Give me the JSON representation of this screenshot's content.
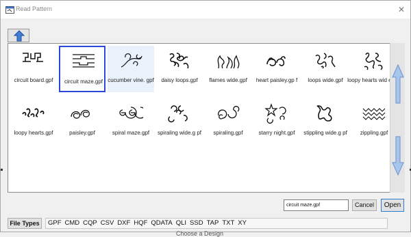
{
  "window": {
    "title": "Read Pattern",
    "close_glyph": "✕"
  },
  "toolbar": {
    "up_icon": "up-arrow-icon"
  },
  "grid": {
    "items": [
      {
        "label": "circuit board.gpf",
        "icon": "circuit-board-pattern-icon",
        "selected": false
      },
      {
        "label": "circuit maze.gpf",
        "icon": "circuit-maze-pattern-icon",
        "selected": true
      },
      {
        "label": "cucumber vine. gpf",
        "icon": "cucumber-vine-pattern-icon",
        "selected": false
      },
      {
        "label": "daisy loops.gpf",
        "icon": "daisy-loops-pattern-icon",
        "selected": false
      },
      {
        "label": "flames wide.gpf",
        "icon": "flames-wide-pattern-icon",
        "selected": false
      },
      {
        "label": "heart paisley.gp f",
        "icon": "heart-paisley-pattern-icon",
        "selected": false
      },
      {
        "label": "loops wide.gpf",
        "icon": "loops-wide-pattern-icon",
        "selected": false
      },
      {
        "label": "loopy hearts wid e.gpf",
        "icon": "loopy-hearts-wide-pattern-icon",
        "selected": false
      },
      {
        "label": "loopy hearts.gpf",
        "icon": "loopy-hearts-pattern-icon",
        "selected": false
      },
      {
        "label": "paisley.gpf",
        "icon": "paisley-pattern-icon",
        "selected": false
      },
      {
        "label": "spiral maze.gpf",
        "icon": "spiral-maze-pattern-icon",
        "selected": false
      },
      {
        "label": "spiraling wide.g pf",
        "icon": "spiraling-wide-pattern-icon",
        "selected": false
      },
      {
        "label": "spiraling.gpf",
        "icon": "spiraling-pattern-icon",
        "selected": false
      },
      {
        "label": "starry night.gpf",
        "icon": "starry-night-pattern-icon",
        "selected": false
      },
      {
        "label": "stippling wide.g pf",
        "icon": "stippling-wide-pattern-icon",
        "selected": false
      },
      {
        "label": "zippling.gpf",
        "icon": "zippling-pattern-icon",
        "selected": false
      }
    ]
  },
  "footer": {
    "filename_value": "circuit maze.gpf",
    "cancel_label": "Cancel",
    "open_label": "Open",
    "file_types_label": "File Types",
    "file_types": [
      "GPF",
      "CMD",
      "CQP",
      "CSV",
      "DXF",
      "HQF",
      "QDATA",
      "QLI",
      "SSD",
      "TAP",
      "TXT",
      "XY"
    ]
  },
  "background": {
    "text": "Choose a Design"
  },
  "colors": {
    "selection_border": "#2a48d8",
    "arrow_blue": "#3f7fd6",
    "scroll_arrow": "#9bbde6"
  }
}
